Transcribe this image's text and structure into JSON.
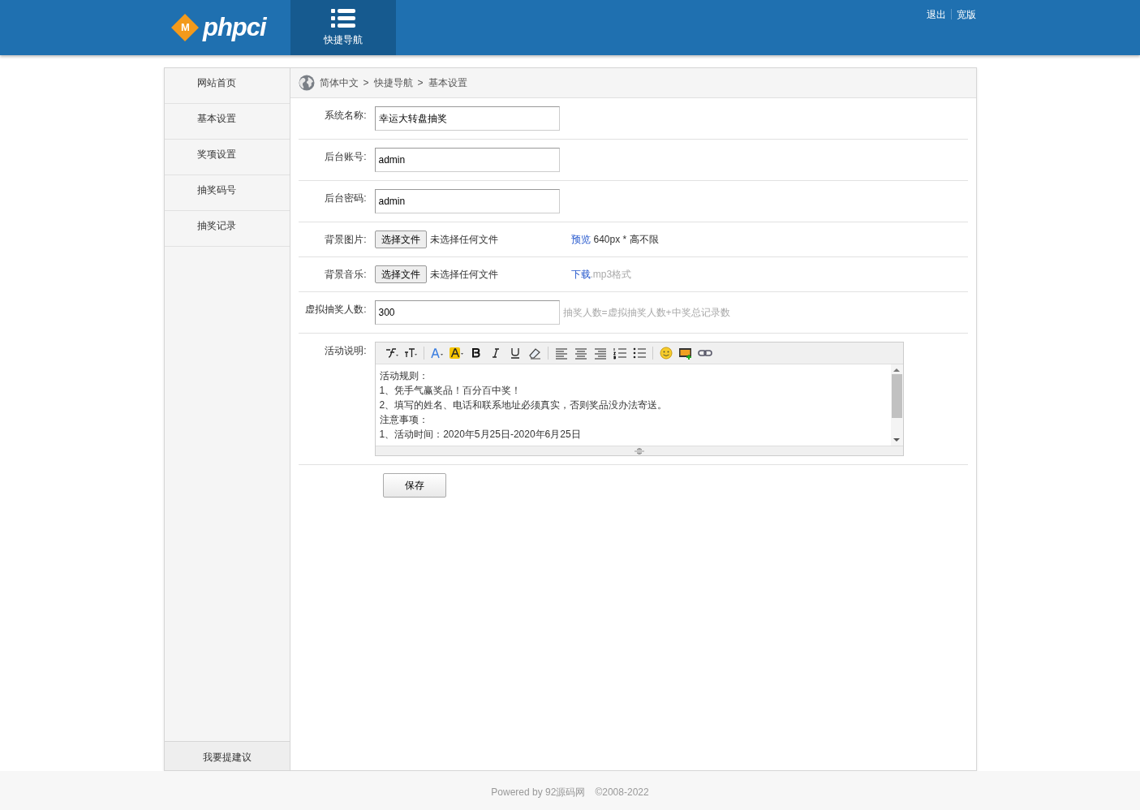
{
  "header": {
    "logo_badge": "M",
    "logo_text": "phpci",
    "nav": [
      {
        "label": "快捷导航",
        "selected": true
      }
    ],
    "links": [
      "退出",
      "宽版"
    ]
  },
  "sidebar": {
    "items": [
      "网站首页",
      "基本设置",
      "奖项设置",
      "抽奖码号",
      "抽奖记录"
    ],
    "suggest": "我要提建议"
  },
  "breadcrumb": [
    "简体中文",
    "快捷导航",
    "基本设置"
  ],
  "breadcrumb_separator": ">",
  "form": [
    {
      "kind": "text",
      "label": "系统名称:",
      "value": "幸运大转盘抽奖"
    },
    {
      "kind": "text",
      "label": "后台账号:",
      "value": "admin"
    },
    {
      "kind": "text",
      "label": "后台密码:",
      "value": "admin"
    },
    {
      "kind": "file",
      "label": "背景图片:",
      "button": "选择文件",
      "status": "未选择任何文件",
      "link": "预览",
      "note": "640px * 高不限",
      "note_muted": false
    },
    {
      "kind": "file",
      "label": "背景音乐:",
      "button": "选择文件",
      "status": "未选择任何文件",
      "link": "下载",
      "note": ".mp3格式",
      "note_muted": true
    },
    {
      "kind": "text",
      "label": "虚拟抽奖人数:",
      "value": "300",
      "hint": "抽奖人数=虚拟抽奖人数+中奖总记录数"
    },
    {
      "kind": "editor",
      "label": "活动说明:",
      "lines": [
        "活动规则：",
        "1、凭手气赢奖品！百分百中奖！",
        "2、填写的姓名、电话和联系地址必须真实，否则奖品没办法寄送。",
        "注意事项：",
        "1、活动时间：2020年5月25日-2020年6月25日"
      ]
    }
  ],
  "toolbar": [
    {
      "kind": "font"
    },
    {
      "kind": "size"
    },
    {
      "kind": "sep"
    },
    {
      "kind": "color"
    },
    {
      "kind": "highlight"
    },
    {
      "kind": "bold"
    },
    {
      "kind": "italic"
    },
    {
      "kind": "underline"
    },
    {
      "kind": "eraser"
    },
    {
      "kind": "sep"
    },
    {
      "kind": "align-left"
    },
    {
      "kind": "align-center"
    },
    {
      "kind": "align-right"
    },
    {
      "kind": "ordered-list"
    },
    {
      "kind": "bullet-list"
    },
    {
      "kind": "sep"
    },
    {
      "kind": "emoji"
    },
    {
      "kind": "image"
    },
    {
      "kind": "link"
    }
  ],
  "save_button": "保存",
  "footer": {
    "powered": "Powered by",
    "site": "92源码网",
    "copyright": "©2008-2022"
  }
}
